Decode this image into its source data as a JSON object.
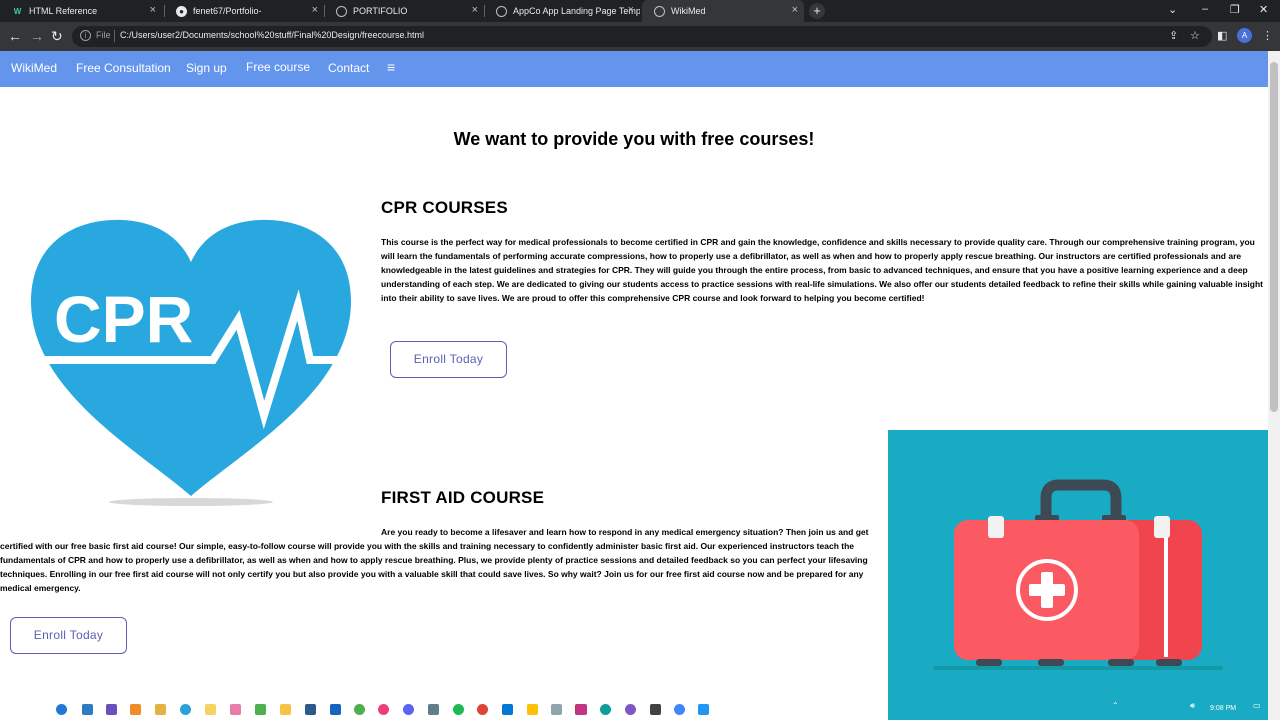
{
  "browser": {
    "tabs": [
      {
        "title": "HTML Reference",
        "favicon": "w-icon",
        "active": false
      },
      {
        "title": "fenet67/Portfolio-",
        "favicon": "github-icon",
        "active": false
      },
      {
        "title": "PORTIFOLIO",
        "favicon": "globe-icon",
        "active": false
      },
      {
        "title": "AppCo App Landing Page Temp",
        "favicon": "globe-icon",
        "active": false
      },
      {
        "title": "WikiMed",
        "favicon": "globe-icon",
        "active": true
      }
    ],
    "address": {
      "scheme_label": "File",
      "url": "C:/Users/user2/Documents/school%20stuff/Final%20Design/freecourse.html"
    },
    "profile_initial": "A"
  },
  "nav": {
    "brand": "WikiMed",
    "items": [
      "Free Consultation",
      "Sign up",
      "Free course",
      "Contact"
    ],
    "menu_icon": "≡"
  },
  "page": {
    "heading": "We want to provide you with free courses!",
    "cpr": {
      "image_text": "CPR",
      "title": "CPR COURSES",
      "body": "This course is the perfect way for medical professionals to become certified in CPR and gain the knowledge, confidence and skills necessary to provide quality care. Through our comprehensive training program, you will learn the fundamentals of performing accurate compressions, how to properly use a defibrillator, as well as when and how to properly apply rescue breathing. Our instructors are certified professionals and are knowledgeable in the latest guidelines and strategies for CPR. They will guide you through the entire process, from basic to advanced techniques, and ensure that you have a positive learning experience and a deep understanding of each step. We are dedicated to giving our students access to practice sessions with real-life simulations. We also offer our students detailed feedback to refine their skills while gaining valuable insight into their ability to save lives. We are proud to offer this comprehensive CPR course and look forward to helping you become certified!",
      "button": "Enroll Today"
    },
    "first_aid": {
      "title": "FIRST AID COURSE",
      "body": "Are you ready to become a lifesaver and learn how to respond in any medical emergency situation? Then join us and get certified with our free basic first aid course! Our simple, easy-to-follow course will provide you with the skills and training necessary to confidently administer basic first aid. Our experienced instructors teach the fundamentals of CPR and how to properly use a defibrillator, as well as when and how to apply rescue breathing. Plus, we provide plenty of practice sessions and detailed feedback so you can perfect your lifesaving techniques. Enrolling in our free first aid course will not only certify you but also provide you with a valuable skill that could save lives. So why wait? Join us for our free first aid course now and be prepared for any medical emergency.",
      "button": "Enroll Today"
    }
  },
  "taskbar": {
    "clock": "9:08 PM"
  },
  "colors": {
    "nav_bg": "#6495ed",
    "cpr_blue": "#29a8e0",
    "first_aid_bg": "#1aabc4",
    "kit_red": "#f0444f",
    "button_border": "#5b5fb6"
  }
}
